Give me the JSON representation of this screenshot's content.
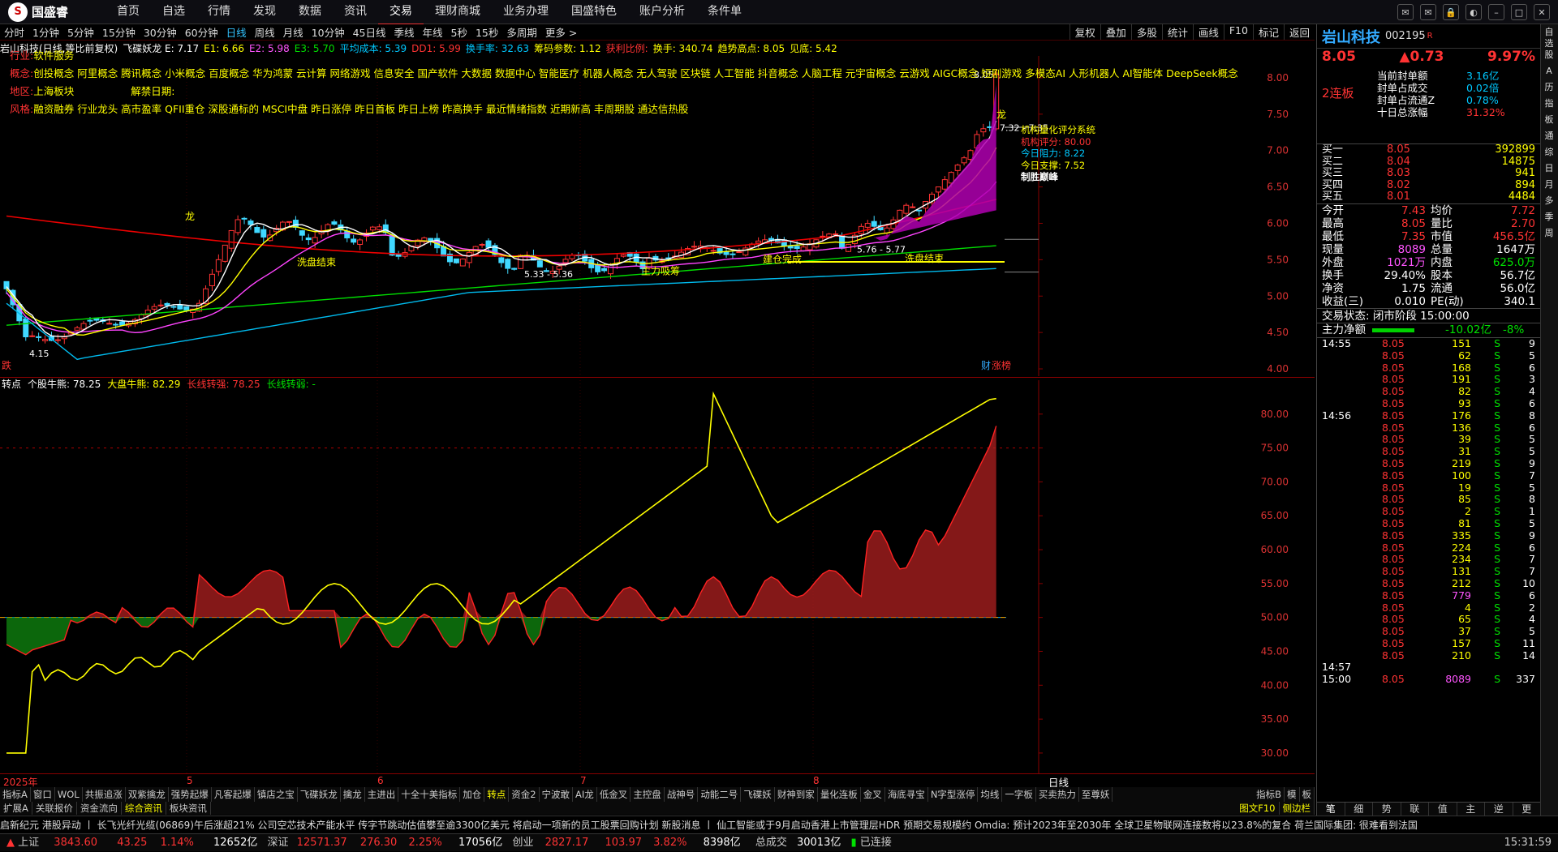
{
  "app": {
    "logo": "国盛睿"
  },
  "menu": [
    "首页",
    "自选",
    "行情",
    "发现",
    "数据",
    "资讯",
    "交易",
    "理财商城",
    "业务办理",
    "国盛特色",
    "账户分析",
    "条件单"
  ],
  "menu_active": 6,
  "window_buttons": [
    "msg-icon",
    "mail-icon",
    "lock-icon",
    "skin-icon",
    "min-icon",
    "max-icon",
    "close-icon"
  ],
  "period_tabs": [
    "分时",
    "1分钟",
    "5分钟",
    "15分钟",
    "30分钟",
    "60分钟",
    "日线",
    "周线",
    "月线",
    "10分钟",
    "45日线",
    "季线",
    "年线",
    "5秒",
    "15秒",
    "多周期",
    "更多 >"
  ],
  "period_active": 6,
  "right_tools": [
    "复权",
    "叠加",
    "多股",
    "统计",
    "画线",
    "F10",
    "标记",
    "返回"
  ],
  "ind1": [
    {
      "t": "岩山科技(日线,等比前复权)",
      "c": "wht"
    },
    {
      "t": "飞碟妖龙 E: 7.17",
      "c": "wht"
    },
    {
      "t": "E1: 6.66",
      "c": "yel"
    },
    {
      "t": "E2: 5.98",
      "c": "mag"
    },
    {
      "t": "E3: 5.70",
      "c": "grn"
    },
    {
      "t": "平均成本: 5.39",
      "c": "cyn"
    },
    {
      "t": "DD1: 5.99",
      "c": "red"
    },
    {
      "t": "换手率: 32.63",
      "c": "cyn"
    },
    {
      "t": "筹码参数: 1.12",
      "c": "yel"
    },
    {
      "t": "获利比例:",
      "c": "red"
    },
    {
      "t": "换手: 340.74",
      "c": "yel"
    },
    {
      "t": "趋势高点: 8.05",
      "c": "yel"
    },
    {
      "t": "见底: 5.42",
      "c": "yel"
    }
  ],
  "chart_overlay": {
    "industry_label": "行业:",
    "industry": "软件服务",
    "concept_label": "概念:",
    "concepts": "创投概念 阿里概念 腾讯概念 小米概念 百度概念 华为鸿蒙 云计算 网络游戏 信息安全 国产软件 大数据 数据中心 智能医疗 机器人概念 无人驾驶 区块链 人工智能 抖音概念 人脑工程 元宇宙概念 云游戏 AIGC概念 短剧游戏 多模态AI 人形机器人 AI智能体 DeepSeek概念",
    "region_label": "地区:",
    "region": "上海板块",
    "unban_label": "解禁日期:",
    "style_label": "风格:",
    "styles": "融资融券 行业龙头 高市盈率 QFII重仓 深股通标的 MSCI中盘 昨日涨停 昨日首板 昨日上榜 昨高换手 最近情绪指数 近期新高 丰周期股 通达信热股",
    "score_title": "机构量化评分系统",
    "score_label": "机构评分:",
    "score": "80.00",
    "resist_label": "今日阻力:",
    "resist": "8.22",
    "support_label": "今日支撑:",
    "support": "7.52",
    "peak_label": "制胜巅峰",
    "ann_xipan1": "洗盘结束",
    "ann_xipan2": "洗盘结束",
    "ann_zhuli": "主力吸筹",
    "ann_jiancang": "建仓完成",
    "ann_long1": "龙",
    "ann_long2": "龙",
    "price_hi": "8.05",
    "price_lo": "4.15",
    "range1": "5.33 - 5.36",
    "range2": "5.76 - 5.77",
    "range3": "7.32 - 7.35",
    "bottom_left": "跌",
    "bottom_right1": "财",
    "bottom_right2": "涨榜"
  },
  "yaxis1": [
    "8.00",
    "7.50",
    "7.00",
    "6.50",
    "6.00",
    "5.50",
    "5.00",
    "4.50",
    "4.00"
  ],
  "ind2": [
    {
      "t": "转点",
      "c": "wht"
    },
    {
      "t": "个股牛熊: 78.25",
      "c": "wht"
    },
    {
      "t": "大盘牛熊: 82.29",
      "c": "yel"
    },
    {
      "t": "长线转强: 78.25",
      "c": "red"
    },
    {
      "t": "长线转弱: -",
      "c": "grn"
    }
  ],
  "yaxis2": [
    "80.00",
    "75.00",
    "70.00",
    "65.00",
    "60.00",
    "55.00",
    "50.00",
    "45.00",
    "40.00",
    "35.00",
    "30.00"
  ],
  "xaxis": [
    "2025年",
    "5",
    "6",
    "7",
    "8"
  ],
  "xaxis_right": "日线",
  "btabs": [
    "指标A",
    "窗口",
    "WOL",
    "共振追涨",
    "双紫擒龙",
    "强势起爆",
    "凡客起爆",
    "镇店之宝",
    "飞碟妖龙",
    "擒龙",
    "主进出",
    "十全十美指标",
    "加仓",
    "转点",
    "资金2",
    "宁波敢",
    "AI龙",
    "低金叉",
    "主控盘",
    "战神号",
    "动能二号",
    "飞碟妖",
    "财神到家",
    "量化连板",
    "金叉",
    "海底寻宝",
    "N字型涨停",
    "均线",
    "一字板",
    "买卖热力",
    "至尊妖"
  ],
  "btabs_active": 13,
  "btabs_right": [
    "指标B",
    "模",
    "板"
  ],
  "btabs2": [
    "扩展A",
    "关联报价",
    "资金流向",
    "综合资讯",
    "板块资讯"
  ],
  "btabs2_active": 3,
  "btabs2_right": [
    "图文F10",
    "侧边栏"
  ],
  "ticker": "启新纪元      港股异动 丨 长飞光纤光缆(06869)午后涨超21% 公司空芯技术产能水平          传字节跳动估值攀至逾3300亿美元 将启动一项新的员工股票回购计划          新股消息 丨 仙工智能或于9月启动香港上市管理层HDR 预期交易规模约          Omdia: 预计2023年至2030年 全球卫星物联网连接数将以23.8%的复合          荷兰国际集团: 很难看到法国",
  "status": {
    "sh_label": "上证",
    "sh": "3843.60",
    "sh_chg": "43.25",
    "sh_pct": "1.14%",
    "sh_amt": "12652亿",
    "sz_label": "深证",
    "sz": "12571.37",
    "sz_chg": "276.30",
    "sz_pct": "2.25%",
    "sz_amt": "17056亿",
    "cy_label": "创业",
    "cy": "2827.17",
    "cy_chg": "103.97",
    "cy_pct": "3.82%",
    "cy_amt": "8398亿",
    "total_label": "总成交",
    "total": "30013亿",
    "conn": "已连接",
    "time": "15:31:59"
  },
  "quote": {
    "name": "岩山科技",
    "code": "002195",
    "tag": "R",
    "price": "8.05",
    "chg": "▲0.73",
    "pct": "9.97%",
    "board": "2连板",
    "seal": [
      [
        "当前封单额",
        "3.16亿"
      ],
      [
        "封单占成交",
        "0.02倍"
      ],
      [
        "封单占流通Z",
        "0.78%"
      ],
      [
        "十日总涨幅",
        "31.32%"
      ]
    ],
    "bids": [
      [
        "买一",
        "8.05",
        "392899"
      ],
      [
        "买二",
        "8.04",
        "14875"
      ],
      [
        "买三",
        "8.03",
        "941"
      ],
      [
        "买四",
        "8.02",
        "894"
      ],
      [
        "买五",
        "8.01",
        "4484"
      ]
    ],
    "stats": [
      [
        "今开",
        "7.43",
        "均价",
        "7.72"
      ],
      [
        "最高",
        "8.05",
        "量比",
        "2.70"
      ],
      [
        "最低",
        "7.35",
        "市值",
        "456.5亿"
      ],
      [
        "现量",
        "8089",
        "总量",
        "1647万"
      ],
      [
        "外盘",
        "1021万",
        "内盘",
        "625.0万"
      ],
      [
        "换手",
        "29.40%",
        "股本",
        "56.7亿"
      ],
      [
        "净资",
        "1.75",
        "流通",
        "56.0亿"
      ],
      [
        "收益(三)",
        "0.010",
        "PE(动)",
        "340.1"
      ]
    ],
    "trade_state": "交易状态: 闭市阶段 15:00:00",
    "net_label": "主力净额",
    "net": "-10.02亿",
    "net_pct": "-8%",
    "ticks": [
      [
        "14:55",
        "8.05",
        "151",
        "S",
        "9"
      ],
      [
        "",
        "8.05",
        "62",
        "S",
        "5"
      ],
      [
        "",
        "8.05",
        "168",
        "S",
        "6"
      ],
      [
        "",
        "8.05",
        "191",
        "S",
        "3"
      ],
      [
        "",
        "8.05",
        "82",
        "S",
        "4"
      ],
      [
        "",
        "8.05",
        "93",
        "S",
        "6"
      ],
      [
        "14:56",
        "8.05",
        "176",
        "S",
        "8"
      ],
      [
        "",
        "8.05",
        "136",
        "S",
        "6"
      ],
      [
        "",
        "8.05",
        "39",
        "S",
        "5"
      ],
      [
        "",
        "8.05",
        "31",
        "S",
        "5"
      ],
      [
        "",
        "8.05",
        "219",
        "S",
        "9"
      ],
      [
        "",
        "8.05",
        "100",
        "S",
        "7"
      ],
      [
        "",
        "8.05",
        "19",
        "S",
        "5"
      ],
      [
        "",
        "8.05",
        "85",
        "S",
        "8"
      ],
      [
        "",
        "8.05",
        "2",
        "S",
        "1"
      ],
      [
        "",
        "8.05",
        "81",
        "S",
        "5"
      ],
      [
        "",
        "8.05",
        "335",
        "S",
        "9"
      ],
      [
        "",
        "8.05",
        "224",
        "S",
        "6"
      ],
      [
        "",
        "8.05",
        "234",
        "S",
        "7"
      ],
      [
        "",
        "8.05",
        "131",
        "S",
        "7"
      ],
      [
        "",
        "8.05",
        "212",
        "S",
        "10"
      ],
      [
        "",
        "8.05",
        "779",
        "S",
        "6"
      ],
      [
        "",
        "8.05",
        "4",
        "S",
        "2"
      ],
      [
        "",
        "8.05",
        "65",
        "S",
        "4"
      ],
      [
        "",
        "8.05",
        "37",
        "S",
        "5"
      ],
      [
        "",
        "8.05",
        "157",
        "S",
        "11"
      ],
      [
        "",
        "8.05",
        "210",
        "S",
        "14"
      ],
      [
        "14:57",
        "",
        "",
        "",
        ""
      ],
      [
        "15:00",
        "8.05",
        "8089",
        "S",
        "337"
      ]
    ],
    "bottom_tabs": [
      "笔",
      "细",
      "势",
      "联",
      "值",
      "主",
      "逆",
      "更"
    ]
  },
  "sidebar": [
    "自选股",
    "A",
    "历",
    "指",
    "板",
    "通",
    "综",
    "日",
    "月",
    "多",
    "季",
    "周"
  ],
  "colors": {
    "up": "#ff3333",
    "down": "#00e0ff",
    "ma_white": "#ffffff",
    "ma_yellow": "#ffff00",
    "ma_magenta": "#ff44ff",
    "ma_green": "#00dd00",
    "ma_red": "#ee0000",
    "ma_cyan": "#00bbee"
  },
  "chart_data": [
    {
      "type": "candlestick",
      "title": "岩山科技(日线,等比前复权)",
      "ylim": [
        3.9,
        8.3
      ],
      "price_high": 8.05,
      "price_low": 4.15,
      "last_close": 8.05
    },
    {
      "type": "area",
      "title": "转点",
      "ylim": [
        27,
        85
      ],
      "baseline": 50,
      "series": [
        {
          "name": "个股牛熊",
          "last": 78.25
        },
        {
          "name": "大盘牛熊",
          "last": 82.29
        }
      ]
    }
  ]
}
